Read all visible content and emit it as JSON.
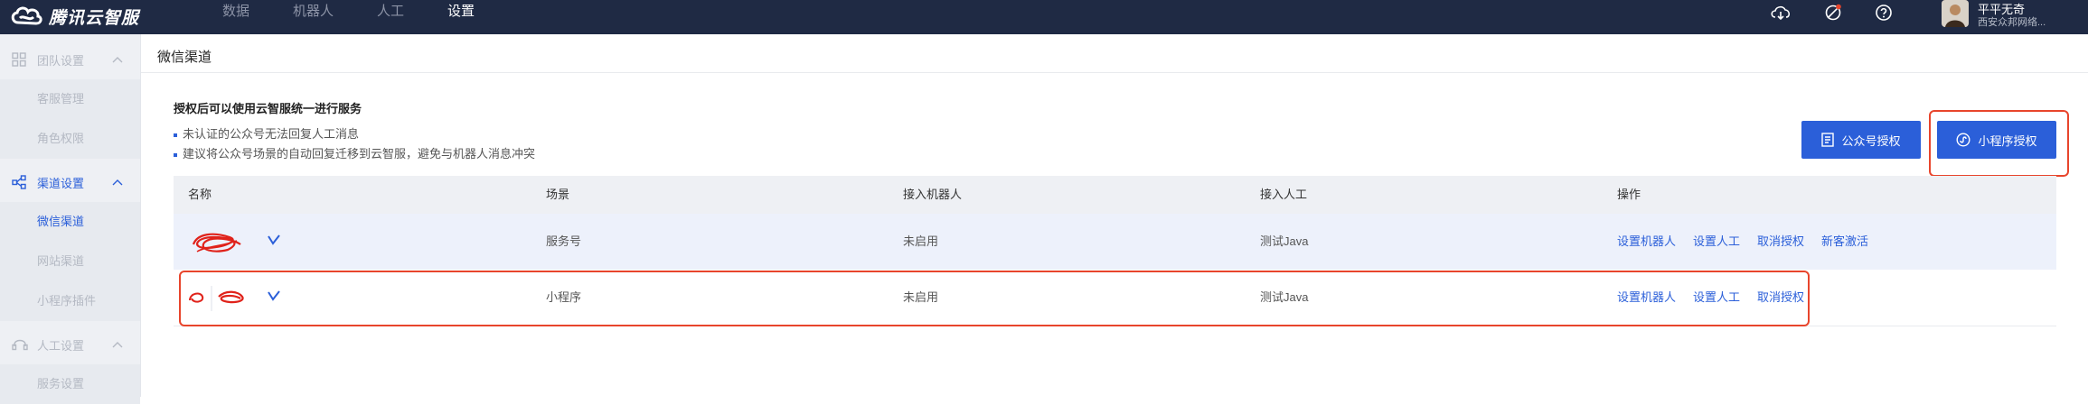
{
  "app": {
    "logo_text": "腾讯云智服",
    "nav": [
      {
        "label": "数据"
      },
      {
        "label": "机器人"
      },
      {
        "label": "人工"
      },
      {
        "label": "设置"
      }
    ],
    "header_icons": [
      "cloud-download-icon",
      "notification-off-icon",
      "help-icon"
    ],
    "user": {
      "name": "平平无奇",
      "org": "西安众邦网络..."
    }
  },
  "sidebar": {
    "groups": [
      {
        "icon": "grid-icon",
        "label": "团队设置",
        "items": [
          {
            "label": "客服管理"
          },
          {
            "label": "角色权限"
          }
        ]
      },
      {
        "icon": "share-nodes-icon",
        "label": "渠道设置",
        "items": [
          {
            "label": "微信渠道"
          },
          {
            "label": "网站渠道"
          },
          {
            "label": "小程序插件"
          }
        ]
      },
      {
        "icon": "headset-icon",
        "label": "人工设置",
        "items": [
          {
            "label": "服务设置"
          }
        ]
      }
    ]
  },
  "page": {
    "title": "微信渠道",
    "notice_title": "授权后可以使用云智服统一进行服务",
    "notices": [
      "未认证的公众号无法回复人工消息",
      "建议将公众号场景的自动回复迁移到云智服，避免与机器人消息冲突"
    ],
    "buttons": {
      "official_account": "公众号授权",
      "mini_program": "小程序授权"
    }
  },
  "table": {
    "headers": [
      "名称",
      "场景",
      "接入机器人",
      "接入人工",
      "操作"
    ],
    "rows": [
      {
        "scene": "服务号",
        "robot": "未启用",
        "human": "测试Java",
        "ops": [
          "设置机器人",
          "设置人工",
          "取消授权",
          "新客激活"
        ]
      },
      {
        "scene": "小程序",
        "robot": "未启用",
        "human": "测试Java",
        "ops": [
          "设置机器人",
          "设置人工",
          "取消授权"
        ]
      }
    ]
  },
  "colors": {
    "topbar": "#1f2a44",
    "accent": "#2b5fd9",
    "highlight": "#e8452c",
    "scribble": "#e0221a"
  }
}
